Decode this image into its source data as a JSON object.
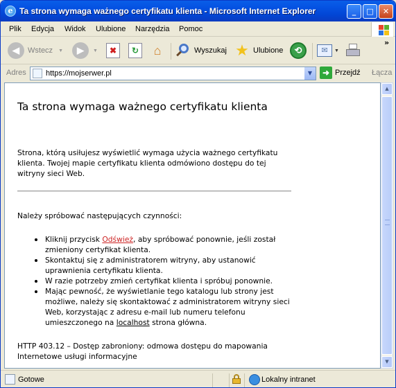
{
  "window": {
    "title": "Ta strona wymaga ważnego certyfikatu klienta - Microsoft Internet Explorer",
    "app_icon": "ie-icon",
    "controls": {
      "minimize": "_",
      "maximize": "□",
      "close": "✕"
    }
  },
  "menu": {
    "items": [
      "Plik",
      "Edycja",
      "Widok",
      "Ulubione",
      "Narzędzia",
      "Pomoc"
    ]
  },
  "toolbar": {
    "back_label": "Wstecz",
    "search_label": "Wyszukaj",
    "favorites_label": "Ulubione",
    "chevron": "»"
  },
  "address": {
    "label": "Adres",
    "url": "https://mojserwer.pl",
    "go_label": "Przejdź",
    "links_label": "Łącza"
  },
  "page": {
    "heading": "Ta strona wymaga ważnego certyfikatu klienta",
    "intro": "Strona, którą usiłujesz wyświetlić wymaga użycia ważnego certyfikatu klienta. Twojej mapie certyfikatu klienta odmówiono dostępu do tej witryny sieci Web.",
    "try_heading": "Należy spróbować następujących czynności:",
    "bullet1_pre": "Kliknij przycisk ",
    "bullet1_link": "Odśwież",
    "bullet1_post": ", aby spróbować ponownie, jeśli został zmieniony certyfikat klienta.",
    "bullet2": "Skontaktuj się z administratorem witryny, aby ustanowić uprawnienia certyfikatu klienta.",
    "bullet3": "W razie potrzeby zmień certyfikat klienta i spróbuj ponownie.",
    "bullet4_pre": "Mając pewność, że wyświetlanie tego katalogu lub strony jest możliwe, należy się skontaktować z administratorem witryny sieci Web, korzystając z adresu e-mail lub numeru telefonu umieszczonego na ",
    "bullet4_link": "localhost",
    "bullet4_post": " strona główna.",
    "error_line1": "HTTP 403.12 – Dostęp zabroniony: odmowa dostępu do mapowania",
    "error_line2": "Internetowe usługi informacyjne"
  },
  "statusbar": {
    "status": "Gotowe",
    "zone": "Lokalny intranet"
  },
  "colors": {
    "titlebar": "#0553e3",
    "link_red": "#cc2222",
    "chrome": "#ece9d8"
  }
}
